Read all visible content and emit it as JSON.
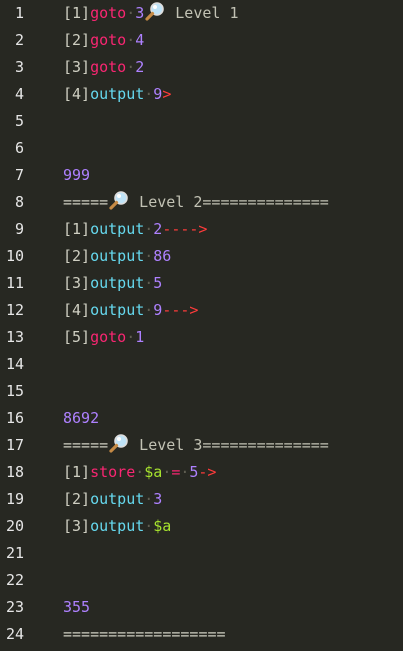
{
  "colors": {
    "background": "#272822",
    "gutter_text": "#e6e6e6",
    "bracket": "#cfcfc2",
    "goto": "#f92672",
    "output": "#66d9ef",
    "number": "#ae81ff",
    "arrow": "#ff3b3b",
    "level": "#c2c2b4",
    "store": "#f92672",
    "variable": "#a6e22e",
    "dot": "#5f5e52"
  },
  "lines": [
    {
      "num": "1",
      "segments": [
        {
          "t": "[1]",
          "c": "bracket"
        },
        {
          "t": "goto",
          "c": "goto"
        },
        {
          "dot": true
        },
        {
          "t": "3",
          "c": "number"
        },
        {
          "icon": "magnifier-icon"
        },
        {
          "t": " Level 1",
          "c": "level"
        }
      ]
    },
    {
      "num": "2",
      "segments": [
        {
          "t": "[2]",
          "c": "bracket"
        },
        {
          "t": "goto",
          "c": "goto"
        },
        {
          "dot": true
        },
        {
          "t": "4",
          "c": "number"
        }
      ]
    },
    {
      "num": "3",
      "segments": [
        {
          "t": "[3]",
          "c": "bracket"
        },
        {
          "t": "goto",
          "c": "goto"
        },
        {
          "dot": true
        },
        {
          "t": "2",
          "c": "number"
        }
      ]
    },
    {
      "num": "4",
      "segments": [
        {
          "t": "[4]",
          "c": "bracket"
        },
        {
          "t": "output",
          "c": "output"
        },
        {
          "dot": true
        },
        {
          "t": "9",
          "c": "number"
        },
        {
          "t": ">",
          "c": "arrow"
        }
      ]
    },
    {
      "num": "5",
      "segments": []
    },
    {
      "num": "6",
      "segments": []
    },
    {
      "num": "7",
      "segments": [
        {
          "t": "999",
          "c": "number"
        }
      ]
    },
    {
      "num": "8",
      "segments": [
        {
          "t": "=====",
          "c": "bracket"
        },
        {
          "icon": "magnifier-icon"
        },
        {
          "t": " Level 2==============",
          "c": "level"
        }
      ]
    },
    {
      "num": "9",
      "segments": [
        {
          "t": "[1]",
          "c": "bracket"
        },
        {
          "t": "output",
          "c": "output"
        },
        {
          "dot": true
        },
        {
          "t": "2",
          "c": "number"
        },
        {
          "t": "---->",
          "c": "arrow"
        }
      ]
    },
    {
      "num": "10",
      "segments": [
        {
          "t": "[2]",
          "c": "bracket"
        },
        {
          "t": "output",
          "c": "output"
        },
        {
          "dot": true
        },
        {
          "t": "86",
          "c": "number"
        }
      ]
    },
    {
      "num": "11",
      "segments": [
        {
          "t": "[3]",
          "c": "bracket"
        },
        {
          "t": "output",
          "c": "output"
        },
        {
          "dot": true
        },
        {
          "t": "5",
          "c": "number"
        }
      ]
    },
    {
      "num": "12",
      "segments": [
        {
          "t": "[4]",
          "c": "bracket"
        },
        {
          "t": "output",
          "c": "output"
        },
        {
          "dot": true
        },
        {
          "t": "9",
          "c": "number"
        },
        {
          "t": "--->",
          "c": "arrow"
        }
      ]
    },
    {
      "num": "13",
      "segments": [
        {
          "t": "[5]",
          "c": "bracket"
        },
        {
          "t": "goto",
          "c": "goto"
        },
        {
          "dot": true
        },
        {
          "t": "1",
          "c": "number"
        }
      ]
    },
    {
      "num": "14",
      "segments": []
    },
    {
      "num": "15",
      "segments": []
    },
    {
      "num": "16",
      "segments": [
        {
          "t": "8692",
          "c": "number"
        }
      ]
    },
    {
      "num": "17",
      "segments": [
        {
          "t": "=====",
          "c": "bracket"
        },
        {
          "icon": "magnifier-icon"
        },
        {
          "t": " Level 3==============",
          "c": "level"
        }
      ]
    },
    {
      "num": "18",
      "segments": [
        {
          "t": "[1]",
          "c": "bracket"
        },
        {
          "t": "store",
          "c": "store"
        },
        {
          "dot": true
        },
        {
          "t": "$a",
          "c": "variable"
        },
        {
          "dot": true
        },
        {
          "t": "=",
          "c": "goto"
        },
        {
          "dot": true
        },
        {
          "t": "5",
          "c": "number"
        },
        {
          "t": "->",
          "c": "arrow"
        }
      ]
    },
    {
      "num": "19",
      "segments": [
        {
          "t": "[2]",
          "c": "bracket"
        },
        {
          "t": "output",
          "c": "output"
        },
        {
          "dot": true
        },
        {
          "t": "3",
          "c": "number"
        }
      ]
    },
    {
      "num": "20",
      "segments": [
        {
          "t": "[3]",
          "c": "bracket"
        },
        {
          "t": "output",
          "c": "output"
        },
        {
          "dot": true
        },
        {
          "t": "$a",
          "c": "variable"
        }
      ]
    },
    {
      "num": "21",
      "segments": []
    },
    {
      "num": "22",
      "segments": []
    },
    {
      "num": "23",
      "segments": [
        {
          "t": "355",
          "c": "number"
        }
      ]
    },
    {
      "num": "24",
      "segments": [
        {
          "t": "==================",
          "c": "bracket"
        }
      ]
    }
  ]
}
